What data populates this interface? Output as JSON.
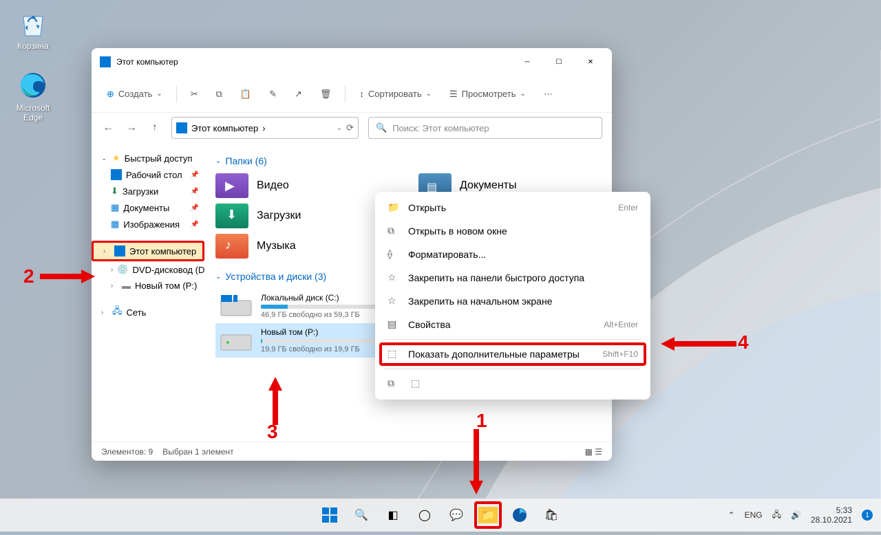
{
  "desktop": {
    "recycle": "Корзина",
    "edge": "Microsoft Edge"
  },
  "window": {
    "title": "Этот компьютер",
    "create": "Создать",
    "sort": "Сортировать",
    "view": "Просмотреть",
    "breadcrumb": "Этот компьютер",
    "search_placeholder": "Поиск: Этот компьютер"
  },
  "sidebar": {
    "quick": "Быстрый доступ",
    "desktop": "Рабочий стол",
    "downloads": "Загрузки",
    "documents": "Документы",
    "pictures": "Изображения",
    "this_pc": "Этот компьютер",
    "dvd": "DVD-дисковод (D:)",
    "volume": "Новый том (P:)",
    "network": "Сеть"
  },
  "content": {
    "folders_hdr": "Папки (6)",
    "videos": "Видео",
    "documents": "Документы",
    "downloads": "Загрузки",
    "music": "Музыка",
    "drives_hdr": "Устройства и диски (3)",
    "local_disk": "Локальный диск (C:)",
    "local_disk_sub": "46,9 ГБ свободно из 59,3 ГБ",
    "local_fill": 21,
    "new_vol": "Новый том (P:)",
    "new_vol_sub": "19,9 ГБ свободно из 19,9 ГБ",
    "new_fill": 1
  },
  "context": {
    "open": "Открыть",
    "open_sc": "Enter",
    "new_window": "Открыть в новом окне",
    "format": "Форматировать...",
    "pin_quick": "Закрепить на панели быстрого доступа",
    "pin_start": "Закрепить на начальном экране",
    "properties": "Свойства",
    "properties_sc": "Alt+Enter",
    "more": "Показать дополнительные параметры",
    "more_sc": "Shift+F10"
  },
  "status": {
    "items": "Элементов: 9",
    "selected": "Выбран 1 элемент"
  },
  "tray": {
    "lang": "ENG",
    "time": "5:33",
    "date": "28.10.2021"
  },
  "callouts": {
    "c1": "1",
    "c2": "2",
    "c3": "3",
    "c4": "4"
  }
}
